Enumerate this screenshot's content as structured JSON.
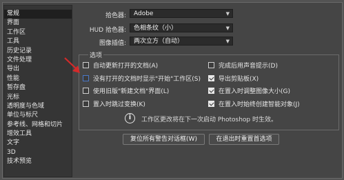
{
  "sidebar": {
    "items": [
      {
        "label": "常规",
        "active": true
      },
      {
        "label": "界面"
      },
      {
        "label": "工作区"
      },
      {
        "label": "工具"
      },
      {
        "label": "历史记录"
      },
      {
        "label": "文件处理"
      },
      {
        "label": "导出"
      },
      {
        "label": "性能"
      },
      {
        "label": "暂存盘"
      },
      {
        "label": "光标"
      },
      {
        "label": "透明度与色域"
      },
      {
        "label": "单位与标尺"
      },
      {
        "label": "参考线、网格和切片"
      },
      {
        "label": "增效工具"
      },
      {
        "label": "文字"
      },
      {
        "label": "3D"
      },
      {
        "label": "技术预览"
      }
    ]
  },
  "pickers": {
    "color_picker_label": "拾色器:",
    "color_picker_value": "Adobe",
    "hud_picker_label": "HUD 拾色器:",
    "hud_picker_value": "色相条纹（小）",
    "interp_label": "图像插值:",
    "interp_value": "两次立方（自动）"
  },
  "options": {
    "title": "选项",
    "auto_update": "自动更新打开的文档(A)",
    "show_start_workspace": "没有打开的文档时显示\"开始\"工作区(S)",
    "legacy_new_doc": "使用旧版\"新建文档\"界面(L)",
    "skip_transform": "置入时跳过变换(K)",
    "beep": "完成后用声音提示(D)",
    "export_clipboard": "导出剪贴板(X)",
    "resize_on_place": "在置入时调整图像大小(G)",
    "smart_objects": "在置入时始终创建智能对象(J)",
    "states": {
      "auto_update": false,
      "show_start_workspace": false,
      "legacy_new_doc": false,
      "skip_transform": false,
      "beep": false,
      "export_clipboard": true,
      "resize_on_place": true,
      "smart_objects": true
    }
  },
  "notice": "工作区更改将在下一次启动 Photoshop 时生效。",
  "buttons": {
    "reset_warnings": "复位所有警告对话框(W)",
    "reset_on_quit": "在退出时重置首选项"
  },
  "colors": {
    "annotation_arrow": "#d42a2a",
    "focus_border": "#4a79c9"
  }
}
